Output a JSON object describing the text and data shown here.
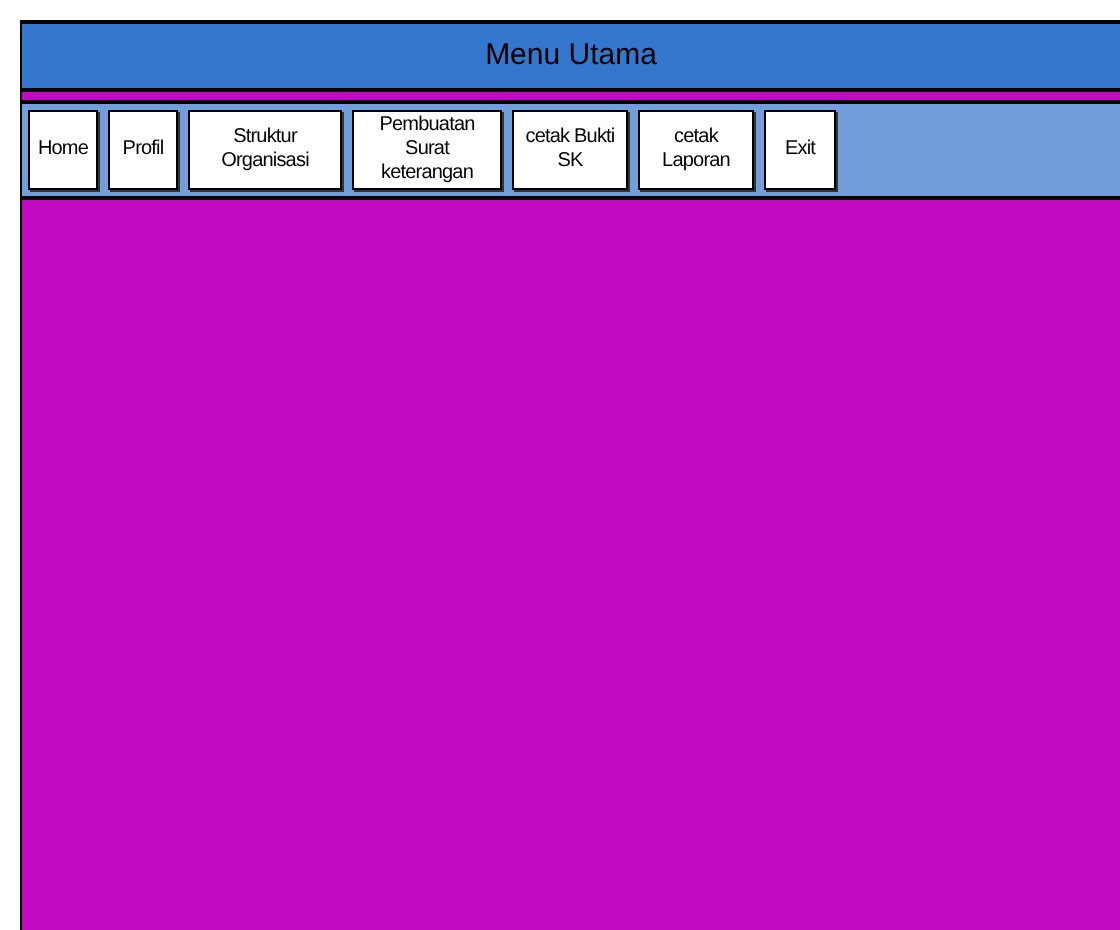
{
  "window": {
    "title": "Menu Utama"
  },
  "menu": [
    {
      "label": "Home"
    },
    {
      "label": "Profil"
    },
    {
      "label": "Struktur Organisasi"
    },
    {
      "label": "Pembuatan Surat keterangan"
    },
    {
      "label": "cetak  Bukti SK"
    },
    {
      "label": "cetak  Laporan"
    },
    {
      "label": "Exit"
    }
  ]
}
